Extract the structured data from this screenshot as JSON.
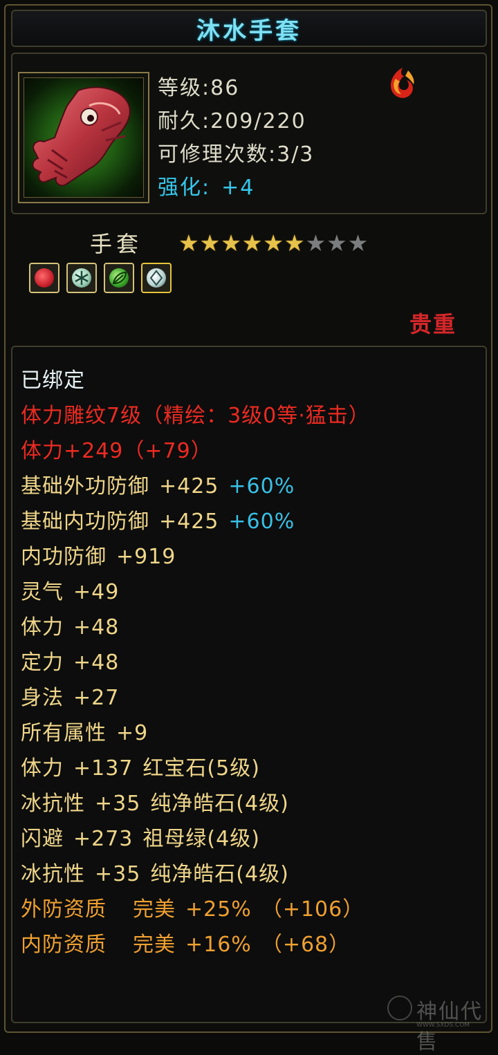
{
  "item": {
    "name": "沐水手套",
    "level_label": "等级:86",
    "durability_label": "耐久:209/220",
    "repair_label": "可修理次数:3/3",
    "enhance_label": "强化:",
    "enhance_value": "+4",
    "type": "手套",
    "stars_filled": 6,
    "stars_total": 9,
    "rarity": "贵重",
    "icon": "red-glove-icon",
    "element_icon": "fire-emblem-icon"
  },
  "gems": [
    {
      "icon": "ruby-gem-icon",
      "color": "#c8202c"
    },
    {
      "icon": "snowflake-gem-icon",
      "color": "#9fd0b8"
    },
    {
      "icon": "leaf-gem-icon",
      "color": "#3aa82a"
    },
    {
      "icon": "crystal-gem-icon",
      "color": "#b8d4d2"
    }
  ],
  "attributes": {
    "bound": "已绑定",
    "carving": "体力雕纹7级（精绘：3级0等·猛击）",
    "stamina_main": "体力+249（+79）",
    "base_ext_def": {
      "label": "基础外功防御",
      "value": "+425",
      "bonus": "+60%"
    },
    "base_int_def": {
      "label": "基础内功防御",
      "value": "+425",
      "bonus": "+60%"
    },
    "int_def": {
      "label": "内功防御",
      "value": "+919"
    },
    "spirit": {
      "label": "灵气",
      "value": "+49"
    },
    "stamina": {
      "label": "体力",
      "value": "+48"
    },
    "focus": {
      "label": "定力",
      "value": "+48"
    },
    "agility": {
      "label": "身法",
      "value": "+27"
    },
    "all_attr": {
      "label": "所有属性",
      "value": "+9"
    },
    "gem1": {
      "label": "体力",
      "value": "+137",
      "gem": "红宝石(5级)"
    },
    "gem2": {
      "label": "冰抗性",
      "value": "+35",
      "gem": "纯净皓石(4级)"
    },
    "gem3": {
      "label": "闪避",
      "value": "+273",
      "gem": "祖母绿(4级)"
    },
    "gem4": {
      "label": "冰抗性",
      "value": "+35",
      "gem": "纯净皓石(4级)"
    },
    "ext_quality": {
      "label": "外防资质",
      "grade": "完美",
      "value": "+25%",
      "extra": "（+106）"
    },
    "int_quality": {
      "label": "内防资质",
      "grade": "完美",
      "value": "+16%",
      "extra": "（+68）"
    }
  },
  "watermark": {
    "text": "神仙代售",
    "url": "WWW.SXDS.COM"
  },
  "colors": {
    "title": "#7fe0f2",
    "bound": "#e8f4f6",
    "carving": "#ec2a22",
    "attribute": "#f0d68a",
    "bonus": "#39c0e6",
    "quality": "#f0a030",
    "rarity": "#d6262a"
  }
}
